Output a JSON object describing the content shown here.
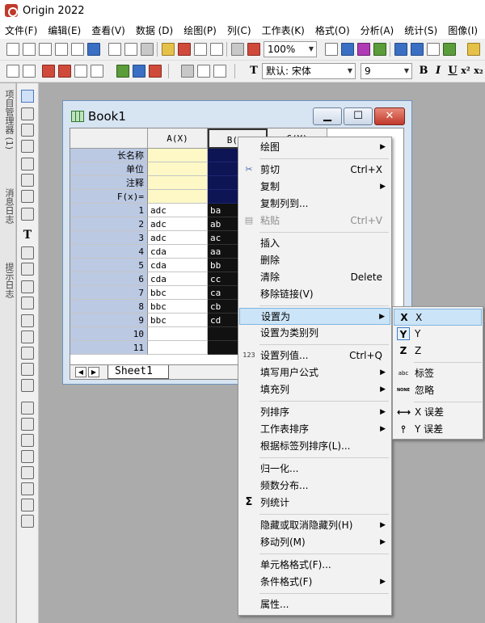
{
  "app": {
    "title": "Origin 2022"
  },
  "menubar": [
    "文件(F)",
    "编辑(E)",
    "查看(V)",
    "数据 (D)",
    "绘图(P)",
    "列(C)",
    "工作表(K)",
    "格式(O)",
    "分析(A)",
    "统计(S)",
    "图像(I)"
  ],
  "toolbar": {
    "zoom": "100%",
    "font_name": "默认: 宋体",
    "font_size": "9",
    "bold": "B",
    "italic": "I",
    "underline": "U",
    "superscript": "x²",
    "subscript": "x₂"
  },
  "left_tabs": [
    "项目管理器 (1)",
    "消息日志",
    "提示日志"
  ],
  "book": {
    "title": "Book1",
    "columns": [
      {
        "header": "A(X)",
        "cells": [
          "adc",
          "adc",
          "adc",
          "cda",
          "cda",
          "cda",
          "bbc",
          "bbc",
          "bbc",
          "",
          ""
        ]
      },
      {
        "header": "B(Y)",
        "cells": [
          "ba",
          "ab",
          "ac",
          "aa",
          "bb",
          "cc",
          "ca",
          "cb",
          "cd",
          "",
          ""
        ]
      },
      {
        "header": "C(Y)"
      }
    ],
    "meta_rows": [
      "长名称",
      "单位",
      "注释",
      "F(x)="
    ],
    "row_numbers": [
      "1",
      "2",
      "3",
      "4",
      "5",
      "6",
      "7",
      "8",
      "9",
      "10",
      "11"
    ],
    "sheet_tab": "Sheet1"
  },
  "context_menu": {
    "plot": "绘图",
    "cut": "剪切",
    "cut_shortcut": "Ctrl+X",
    "copy": "复制",
    "copy_to": "复制列到...",
    "paste": "粘贴",
    "paste_shortcut": "Ctrl+V",
    "insert": "插入",
    "delete": "删除",
    "clear": "清除",
    "clear_shortcut": "Delete",
    "remove_link": "移除链接(V)",
    "set_as": "设置为",
    "set_as_category": "设置为类别列",
    "set_values": "设置列值...",
    "set_values_shortcut": "Ctrl+Q",
    "fill_formula": "填写用户公式",
    "fill_column": "填充列",
    "sort_column": "列排序",
    "sort_worksheet": "工作表排序",
    "sort_by_label": "根据标签列排序(L)...",
    "normalize": "归一化...",
    "frequency": "频数分布...",
    "statistics": "列统计",
    "hide_unhide": "隐藏或取消隐藏列(H)",
    "move_column": "移动列(M)",
    "cell_format": "单元格格式(F)...",
    "conditional_format": "条件格式(F)",
    "properties": "属性..."
  },
  "submenu": {
    "x": "X",
    "y": "Y",
    "z": "Z",
    "label": "标签",
    "ignore": "忽略",
    "x_error": "X 误差",
    "y_error": "Y 误差",
    "icon_label_text": "abc",
    "icon_ignore_text": "NONE",
    "icon_x": "X",
    "icon_y": "Y",
    "icon_z": "Z"
  },
  "icons": {
    "set_values_icon_text": "123",
    "statistics_icon_text": "Σ"
  }
}
